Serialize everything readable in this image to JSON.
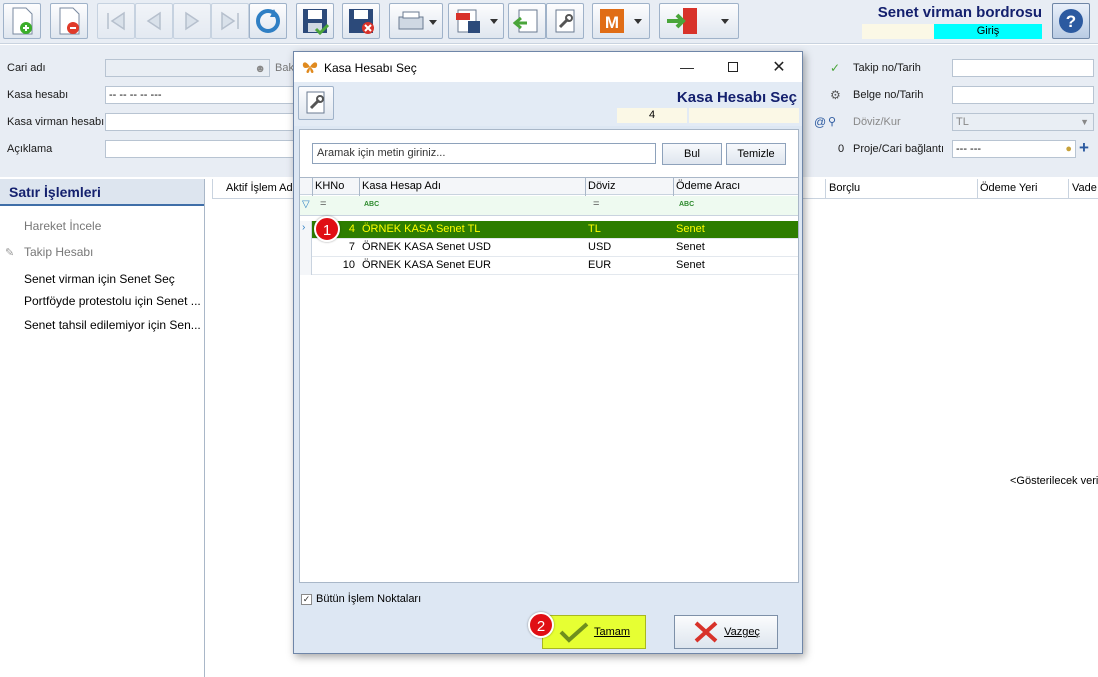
{
  "toolbar": {
    "title": "Senet virman bordrosu",
    "status": "Giriş"
  },
  "form": {
    "cari_adi_label": "Cari adı",
    "bak_label": "Bak",
    "kasa_hesabi_label": "Kasa hesabı",
    "kasa_hesabi_value": "-- -- -- -- ---",
    "kasa_virman_label": "Kasa virman hesabı",
    "aciklama_label": "Açıklama",
    "takip_label": "Takip no/Tarih",
    "belge_label": "Belge no/Tarih",
    "doviz_label": "Döviz/Kur",
    "doviz_value": "TL",
    "doviz_kur_value": "0",
    "proje_label": "Proje/Cari bağlantı",
    "proje_value": "--- ---"
  },
  "left_panel": {
    "title": "Satır İşlemleri",
    "items": [
      {
        "label": "Hareket İncele",
        "enabled": false
      },
      {
        "label": "Takip Hesabı",
        "enabled": false
      },
      {
        "label": "Senet virman için Senet Seç",
        "enabled": true
      },
      {
        "label": "Portföyde protestolu için Senet ...",
        "enabled": true
      },
      {
        "label": "Senet tahsil edilemiyor için Sen...",
        "enabled": true
      }
    ]
  },
  "background_grid": {
    "columns": [
      "Aktif İşlem Adı",
      "Borçlu",
      "Ödeme Yeri",
      "Vade"
    ],
    "info": "<Gösterilecek veri"
  },
  "dialog": {
    "title": "Kasa Hesabı Seç",
    "header_title": "Kasa Hesabı Seç",
    "count": "4",
    "search_placeholder": "Aramak için metin giriniz...",
    "find_button": "Bul",
    "clear_button": "Temizle",
    "columns": [
      "KHNo",
      "Kasa Hesap Adı",
      "Döviz",
      "Ödeme Aracı"
    ],
    "filter_row": {
      "eq1": "=",
      "abc1": "ABC",
      "eq2": "=",
      "abc2": "ABC"
    },
    "rows": [
      {
        "no": "4",
        "name": "ÖRNEK KASA Senet TL",
        "currency": "TL",
        "method": "Senet",
        "selected": true
      },
      {
        "no": "7",
        "name": "ÖRNEK KASA Senet USD",
        "currency": "USD",
        "method": "Senet",
        "selected": false
      },
      {
        "no": "10",
        "name": "ÖRNEK KASA Senet EUR",
        "currency": "EUR",
        "method": "Senet",
        "selected": false
      }
    ],
    "all_points_label": "Bütün İşlem Noktaları",
    "all_points_checked": true,
    "ok_button": "Tamam",
    "cancel_button": "Vazgeç"
  },
  "annotations": {
    "badge1": "1",
    "badge2": "2"
  },
  "colors": {
    "selected_row_bg": "#2d7d00",
    "selected_row_text": "#ffff00",
    "ok_button_highlight": "#e6ff33",
    "status_bg": "#00ffff",
    "title_color": "#14206e",
    "badge": "#e00e14"
  }
}
